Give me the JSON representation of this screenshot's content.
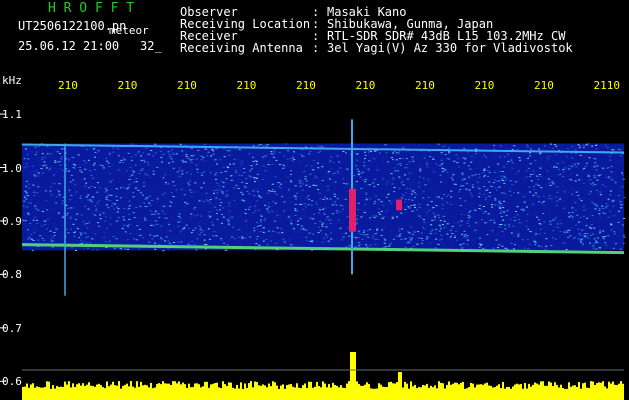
{
  "header": {
    "app_title": "H R O F F T",
    "file_name": "UT2506122100.pn",
    "mode_label": "meteor",
    "datetime": "25.06.12 21:00",
    "count": "32_",
    "info": [
      {
        "label": "Observer",
        "value": "Masaki Kano"
      },
      {
        "label": "Receiving Location",
        "value": "Shibukawa, Gunma, Japan"
      },
      {
        "label": "Receiver",
        "value": "RTL-SDR SDR# 43dB L15 103.2MHz CW"
      },
      {
        "label": "Receiving Antenna",
        "value": "3el Yagi(V) Az 330 for Vladivostok"
      }
    ]
  },
  "chart_data": {
    "type": "heatmap",
    "ylabel": "kHz",
    "y_ticks": [
      "1.1",
      "1.0",
      "0.9",
      "0.8",
      "0.7",
      "0.6"
    ],
    "x_ticks": [
      "210",
      "210",
      "210",
      "210",
      "210",
      "210",
      "210",
      "210",
      "210",
      "2110"
    ],
    "ylim": [
      0.58,
      1.16
    ],
    "signal_band_khz": [
      0.845,
      1.045
    ],
    "bright_line_khz": 0.852,
    "upper_edge_khz": 1.043,
    "meteor_echoes": [
      {
        "x_index": 5.5,
        "khz_min": 0.88,
        "khz_max": 0.96
      },
      {
        "x_index": 6.0,
        "khz_min": 0.92,
        "khz_max": 0.94
      }
    ],
    "colors": {
      "background": "#000000",
      "noise_low": "#0a1a9e",
      "noise_mid": "#1e5bd0",
      "noise_high": "#3fa8e8",
      "line": "#55d07a",
      "echo": "#e0206a",
      "axis_text": "#ffff00",
      "power_bar": "#ffff00"
    }
  },
  "colors": {
    "title": "#22cc22",
    "header_text": "#ffffff",
    "ytick": "#ffffff",
    "xtick": "#ffff00"
  }
}
